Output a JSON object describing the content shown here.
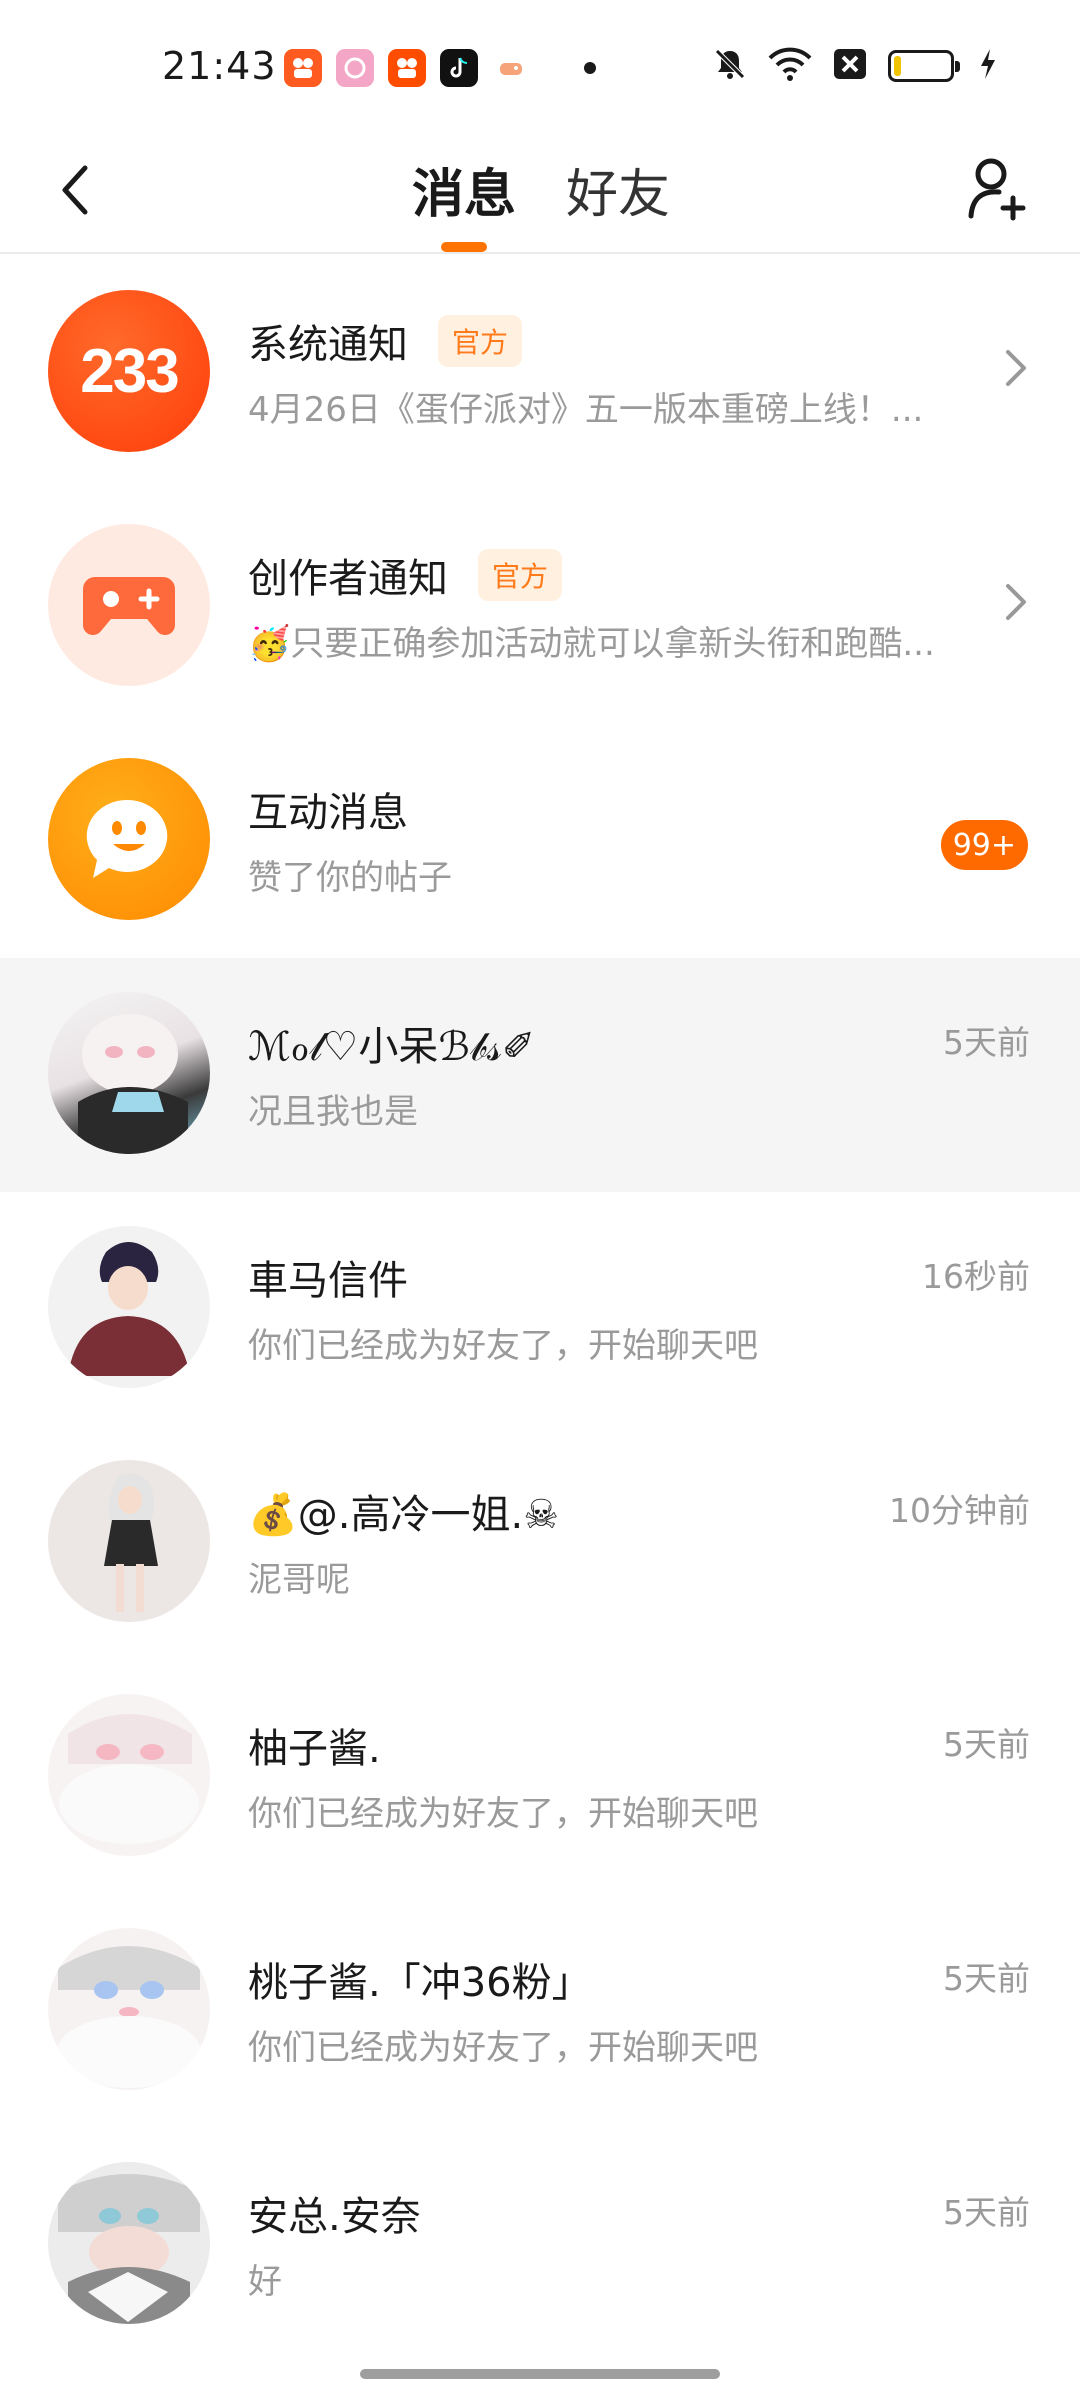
{
  "status_bar": {
    "time": "21:43",
    "apps": [
      {
        "icon": "kuaishou-lite-icon",
        "color": "#ff5a1f"
      },
      {
        "icon": "camera-app-icon",
        "color": "#f4a6c7"
      },
      {
        "icon": "kuaishou-icon",
        "color": "#ff4d00"
      },
      {
        "icon": "tiktok-icon",
        "color": "#111111"
      },
      {
        "icon": "game-app-icon",
        "color": "#f7c8a0"
      }
    ],
    "icons": [
      "notification-muted-icon",
      "wifi-icon",
      "sim-disabled-icon",
      "battery-icon",
      "charging-icon"
    ]
  },
  "nav": {
    "tabs": [
      {
        "label": "消息",
        "active": true
      },
      {
        "label": "好友",
        "active": false
      }
    ],
    "accent_color": "#ff7300"
  },
  "items": [
    {
      "avatar": {
        "text": "233",
        "icon": "app-logo-233-icon",
        "color": "#ff4f1a"
      },
      "title": "系统通知",
      "badge": "官方",
      "subtitle": "4月26日《蛋仔派对》五一版本重磅上线！...",
      "action": "chevron-right"
    },
    {
      "avatar": {
        "icon": "gamepad-icon",
        "color": "#ff6a3d",
        "bg": "#ffeae2"
      },
      "title": "创作者通知",
      "badge": "官方",
      "subtitle": "🥳只要正确参加活动就可以拿新头衔和跑酷...",
      "action": "chevron-right"
    },
    {
      "avatar": {
        "icon": "smile-chat-icon",
        "color": "#ff8a00"
      },
      "title": "互动消息",
      "subtitle": "赞了你的帖子",
      "count": "99+"
    },
    {
      "avatar": {
        "icon": "user-avatar-icon"
      },
      "title": "ℳℴ𝓁♡小呆ℬ𝒷𝓈✐",
      "subtitle": "况且我也是",
      "time": "5天前",
      "highlight": true
    },
    {
      "avatar": {
        "icon": "user-avatar-icon"
      },
      "title": "車马信件",
      "subtitle": "你们已经成为好友了，开始聊天吧",
      "time": "16秒前"
    },
    {
      "avatar": {
        "icon": "user-avatar-icon"
      },
      "title": "💰@.高冷一姐.☠",
      "subtitle": "泥哥呢",
      "time": "10分钟前"
    },
    {
      "avatar": {
        "icon": "user-avatar-icon"
      },
      "title": "柚子酱.",
      "subtitle": "你们已经成为好友了，开始聊天吧",
      "time": "5天前"
    },
    {
      "avatar": {
        "icon": "user-avatar-icon"
      },
      "title": "桃子酱.「冲36粉」",
      "subtitle": "你们已经成为好友了，开始聊天吧",
      "time": "5天前"
    },
    {
      "avatar": {
        "icon": "user-avatar-icon"
      },
      "title": "安总.安奈",
      "subtitle": "好",
      "time": "5天前"
    }
  ]
}
